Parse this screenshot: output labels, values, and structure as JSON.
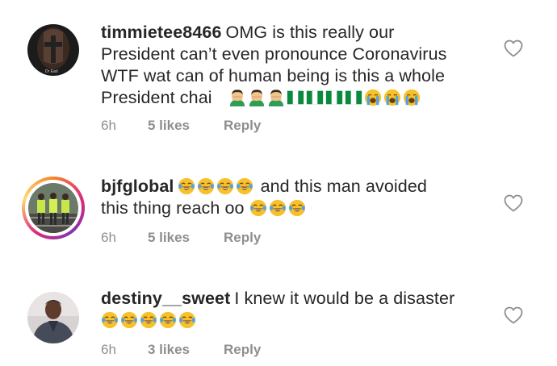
{
  "comments": [
    {
      "username": "timmietee8466",
      "line1": "OMG is this really our",
      "line2": "President can’t even pronounce Coronavirus",
      "line3": "WTF wat can of human being is this a whole",
      "line4": "President chai",
      "time": "6h",
      "likes": "5 likes",
      "reply": "Reply",
      "avatar_caption": "Dr Earl"
    },
    {
      "username": "bjfglobal",
      "line1": "and this man avoided",
      "line2": "this thing reach oo",
      "time": "6h",
      "likes": "5 likes",
      "reply": "Reply"
    },
    {
      "username": "destiny__sweet",
      "line1": "I knew it would be a disaster",
      "time": "6h",
      "likes": "3 likes",
      "reply": "Reply"
    }
  ],
  "colors": {
    "text": "#262626",
    "meta": "#8e8e8e",
    "heart_outline": "#8e8e8e",
    "story_ring": "#dd2a7b"
  },
  "icons": [
    "heart-outline-icon",
    "woman-facepalming-emoji",
    "nigeria-flag-emoji",
    "loudly-crying-emoji",
    "tears-of-joy-emoji"
  ]
}
